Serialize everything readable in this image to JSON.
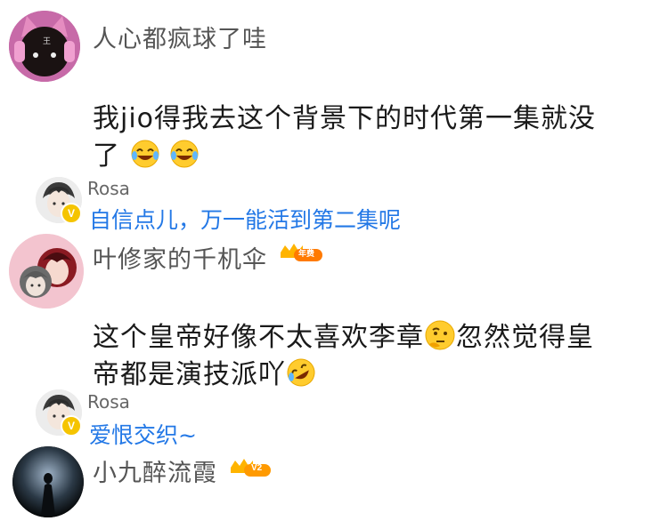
{
  "comments": [
    {
      "user": "人心都疯球了哇",
      "text_line1": "我jio得我去这个背景下的时代第一集就没",
      "text_line2": "了",
      "emoji": "laughing-tears-emoji",
      "reply": {
        "user": "Rosa",
        "text": "自信点儿，万一能活到第二集呢"
      }
    },
    {
      "user": "叶修家的千机伞",
      "badge": "年费",
      "text_line1_a": "这个皇帝好像不太喜欢李章",
      "text_line1_emoji": "thinking-emoji",
      "text_line1_b": "忽然觉得皇",
      "text_line2": "帝都是演技派吖",
      "text_line2_emoji": "rolling-laugh-emoji",
      "reply": {
        "user": "Rosa",
        "text": "爱恨交织~"
      }
    },
    {
      "user": "小九醉流霞",
      "badge": "V2"
    }
  ],
  "colors": {
    "reply_link": "#2378e6",
    "name": "#555555",
    "badge_gold": "#f5b400"
  }
}
